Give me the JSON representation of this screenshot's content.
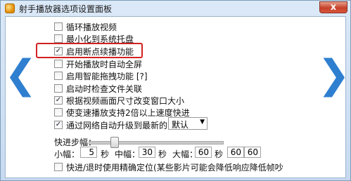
{
  "window": {
    "title": "射手播放器选项设置面板",
    "close_label": "x"
  },
  "nav": {
    "prev": "❮",
    "next": "❯"
  },
  "options": [
    {
      "label": "循环播放视频",
      "checked": false
    },
    {
      "label": "最小化到系统托盘",
      "checked": false
    },
    {
      "label": "启用断点续播功能",
      "checked": true
    },
    {
      "label": "开始播放时自动全屏",
      "checked": false
    },
    {
      "label": "启用智能拖拽功能  [?]",
      "checked": false
    },
    {
      "label": "启动时检查文件关联",
      "checked": false
    },
    {
      "label": "根据视频画面尺寸改变窗口大小",
      "checked": true
    },
    {
      "label": "使变速播放支持2倍以上速度快进",
      "checked": false
    },
    {
      "label": "通过网络自动升级到最新的",
      "checked": true
    }
  ],
  "upgrade_channel": {
    "selected": "默认"
  },
  "seek": {
    "title": "快进步幅：",
    "small_label": "小幅：",
    "small_value": "5",
    "small_unit": "秒",
    "medium_label": "中幅：",
    "medium_value": "30",
    "medium_unit": "秒",
    "large_label": "大幅：",
    "large_value": "60",
    "large_unit": "秒",
    "extra_values": [
      "60",
      "60"
    ]
  },
  "accurate_seek": {
    "label": "快进/退时使用精确定位(某些影片可能会降低响应降低帧吵",
    "checked": false
  }
}
